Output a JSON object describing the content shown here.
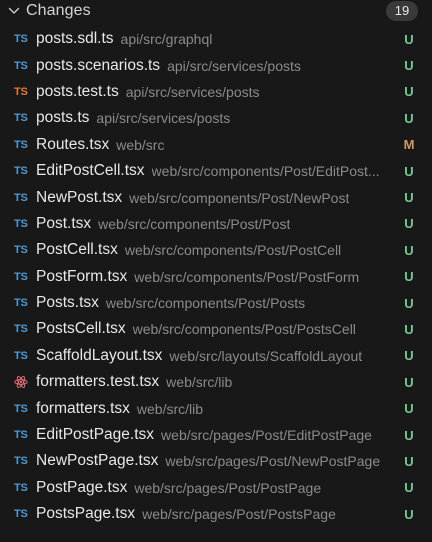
{
  "header": {
    "title": "Changes",
    "count": "19"
  },
  "colors": {
    "background": "#181818",
    "ts_icon": "#4e9ad6",
    "test_icon": "#e37933",
    "react_icon": "#e06c75",
    "untracked": "#73c991",
    "modified": "#d19a66"
  },
  "files": [
    {
      "icon": "ts",
      "icon_text": "TS",
      "name": "posts.sdl.ts",
      "path": "api/src/graphql",
      "status": "U"
    },
    {
      "icon": "ts",
      "icon_text": "TS",
      "name": "posts.scenarios.ts",
      "path": "api/src/services/posts",
      "status": "U"
    },
    {
      "icon": "test",
      "icon_text": "TS",
      "name": "posts.test.ts",
      "path": "api/src/services/posts",
      "status": "U"
    },
    {
      "icon": "ts",
      "icon_text": "TS",
      "name": "posts.ts",
      "path": "api/src/services/posts",
      "status": "U"
    },
    {
      "icon": "ts",
      "icon_text": "TS",
      "name": "Routes.tsx",
      "path": "web/src",
      "status": "M"
    },
    {
      "icon": "ts",
      "icon_text": "TS",
      "name": "EditPostCell.tsx",
      "path": "web/src/components/Post/EditPost...",
      "status": "U"
    },
    {
      "icon": "ts",
      "icon_text": "TS",
      "name": "NewPost.tsx",
      "path": "web/src/components/Post/NewPost",
      "status": "U"
    },
    {
      "icon": "ts",
      "icon_text": "TS",
      "name": "Post.tsx",
      "path": "web/src/components/Post/Post",
      "status": "U"
    },
    {
      "icon": "ts",
      "icon_text": "TS",
      "name": "PostCell.tsx",
      "path": "web/src/components/Post/PostCell",
      "status": "U"
    },
    {
      "icon": "ts",
      "icon_text": "TS",
      "name": "PostForm.tsx",
      "path": "web/src/components/Post/PostForm",
      "status": "U"
    },
    {
      "icon": "ts",
      "icon_text": "TS",
      "name": "Posts.tsx",
      "path": "web/src/components/Post/Posts",
      "status": "U"
    },
    {
      "icon": "ts",
      "icon_text": "TS",
      "name": "PostsCell.tsx",
      "path": "web/src/components/Post/PostsCell",
      "status": "U"
    },
    {
      "icon": "ts",
      "icon_text": "TS",
      "name": "ScaffoldLayout.tsx",
      "path": "web/src/layouts/ScaffoldLayout",
      "status": "U"
    },
    {
      "icon": "react",
      "icon_text": "",
      "name": "formatters.test.tsx",
      "path": "web/src/lib",
      "status": "U"
    },
    {
      "icon": "ts",
      "icon_text": "TS",
      "name": "formatters.tsx",
      "path": "web/src/lib",
      "status": "U"
    },
    {
      "icon": "ts",
      "icon_text": "TS",
      "name": "EditPostPage.tsx",
      "path": "web/src/pages/Post/EditPostPage",
      "status": "U"
    },
    {
      "icon": "ts",
      "icon_text": "TS",
      "name": "NewPostPage.tsx",
      "path": "web/src/pages/Post/NewPostPage",
      "status": "U"
    },
    {
      "icon": "ts",
      "icon_text": "TS",
      "name": "PostPage.tsx",
      "path": "web/src/pages/Post/PostPage",
      "status": "U"
    },
    {
      "icon": "ts",
      "icon_text": "TS",
      "name": "PostsPage.tsx",
      "path": "web/src/pages/Post/PostsPage",
      "status": "U"
    }
  ]
}
